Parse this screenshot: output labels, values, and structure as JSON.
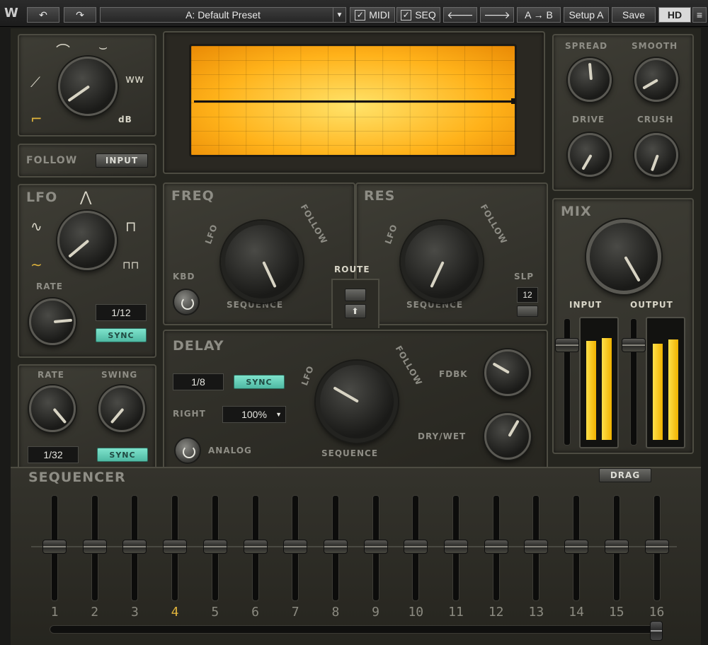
{
  "toolbar": {
    "undo_icon": "undo-icon",
    "redo_icon": "redo-icon",
    "preset_name": "A: Default Preset",
    "midi_label": "MIDI",
    "seq_label": "SEQ",
    "prev_icon": "arrow-left-icon",
    "next_icon": "arrow-right-icon",
    "ab_label": "A → B",
    "setup_label": "Setup A",
    "save_label": "Save",
    "hd_label": "HD",
    "midi_checked": true,
    "seq_checked": true
  },
  "filter_type": {
    "label_db": "dB"
  },
  "follow": {
    "label": "FOLLOW",
    "button": "INPUT"
  },
  "lfo": {
    "label": "LFO",
    "rate_label": "RATE",
    "rate_value": "1/12",
    "sync_label": "SYNC"
  },
  "seq_controls": {
    "rate_label": "RATE",
    "swing_label": "SWING",
    "rate_value": "1/32",
    "sync_label": "SYNC"
  },
  "freq": {
    "label": "FREQ",
    "kbd_label": "KBD",
    "lfo_label": "LFO",
    "follow_label": "FOLLOW",
    "sequence_label": "SEQUENCE"
  },
  "res": {
    "label": "RES",
    "lfo_label": "LFO",
    "follow_label": "FOLLOW",
    "sequence_label": "SEQUENCE",
    "slp_label": "SLP",
    "slp_value": "12"
  },
  "route": {
    "label": "ROUTE"
  },
  "delay": {
    "label": "DELAY",
    "time_value": "1/8",
    "sync_label": "SYNC",
    "right_label": "RIGHT",
    "right_value": "100%",
    "analog_label": "ANALOG",
    "lfo_label": "LFO",
    "follow_label": "FOLLOW",
    "sequence_label": "SEQUENCE",
    "fdbk_label": "FDBK",
    "drywet_label": "DRY/WET"
  },
  "fx": {
    "spread_label": "SPREAD",
    "smooth_label": "SMOOTH",
    "drive_label": "DRIVE",
    "crush_label": "CRUSH"
  },
  "mix": {
    "label": "MIX",
    "input_label": "INPUT",
    "output_label": "OUTPUT"
  },
  "sequencer": {
    "label": "SEQUENCER",
    "drag_label": "DRAG",
    "active_step": 4,
    "steps": [
      "1",
      "2",
      "3",
      "4",
      "5",
      "6",
      "7",
      "8",
      "9",
      "10",
      "11",
      "12",
      "13",
      "14",
      "15",
      "16"
    ]
  },
  "colors": {
    "accent_sync": "#5fcdb5",
    "screen": "#ffb21a",
    "meter": "#f0c000",
    "active_step": "#e0b43c"
  }
}
